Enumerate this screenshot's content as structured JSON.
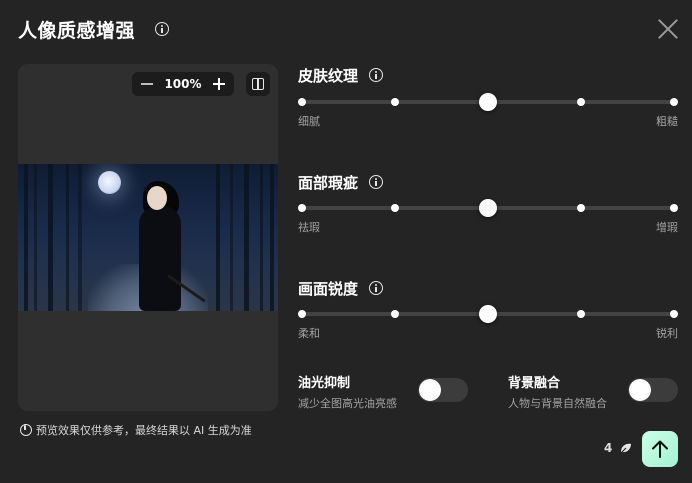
{
  "dialog": {
    "title": "人像质感增强",
    "close_icon": "close-icon",
    "title_info_icon": "info-icon"
  },
  "preview": {
    "zoom_value": "100%",
    "zoom_out_icon": "minus-icon",
    "zoom_in_icon": "plus-icon",
    "compare_icon": "split-compare-icon",
    "note": "预览效果仅供参考，最终结果以 AI 生成为准"
  },
  "sliders": [
    {
      "title": "皮肤纹理",
      "left": "细腻",
      "right": "粗糙",
      "value_fraction": 0.5,
      "steps": 5
    },
    {
      "title": "面部瑕疵",
      "left": "祛瑕",
      "right": "增瑕",
      "value_fraction": 0.5,
      "steps": 5
    },
    {
      "title": "画面锐度",
      "left": "柔和",
      "right": "锐利",
      "value_fraction": 0.5,
      "steps": 5
    }
  ],
  "toggles": [
    {
      "title": "油光抑制",
      "desc": "减少全图高光油亮感",
      "on": false
    },
    {
      "title": "背景融合",
      "desc": "人物与背景自然融合",
      "on": false
    }
  ],
  "footer": {
    "credits": "4",
    "credits_icon": "leaf-icon",
    "submit_icon": "arrow-up-icon"
  },
  "colors": {
    "background": "#242424",
    "panel": "#2f2f2f",
    "track": "#434343",
    "submit_accent": "#b5f7dc"
  }
}
